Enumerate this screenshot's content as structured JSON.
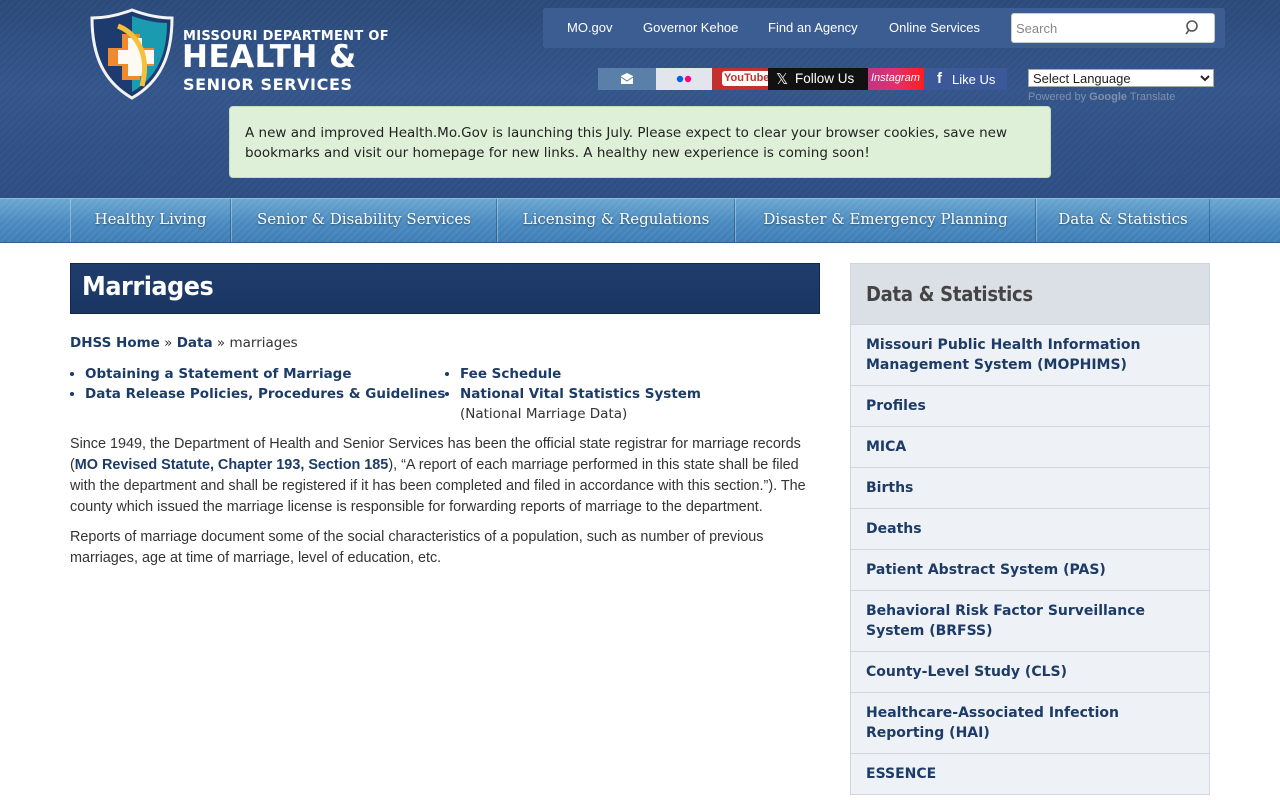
{
  "header": {
    "logo": {
      "line1": "MISSOURI DEPARTMENT OF",
      "line2": "HEALTH &",
      "line3": "SENIOR SERVICES"
    },
    "top_links": [
      "MO.gov",
      "Governor Kehoe",
      "Find an Agency",
      "Online Services"
    ],
    "search": {
      "placeholder": "Search"
    },
    "social": {
      "youtube": "YouTube",
      "x": "Follow Us",
      "instagram": "Instagram",
      "facebook": "Like Us"
    },
    "language": {
      "selected": "Select Language"
    },
    "powered_by": {
      "prefix": "Powered by",
      "google": "Google",
      "suffix": "Translate"
    }
  },
  "alert": {
    "text": "A new and improved Health.Mo.Gov is launching this July. Please expect to clear your browser cookies, save new bookmarks and visit our homepage for new links. A healthy new experience is coming soon!"
  },
  "main_nav": [
    "Healthy Living",
    "Senior & Disability Services",
    "Licensing & Regulations",
    "Disaster & Emergency Planning",
    "Data & Statistics"
  ],
  "page": {
    "title": "Marriages",
    "breadcrumb": {
      "home": "DHSS Home",
      "sep": "»",
      "data": "Data",
      "current": "marriages"
    },
    "links_left": [
      "Obtaining a Statement of Marriage",
      "Data Release Policies, Procedures & Guidelines"
    ],
    "links_right": [
      "Fee Schedule",
      "National Vital Statistics System"
    ],
    "links_right_note": "(National Marriage Data)",
    "para1_start": "Since 1949, the Department of Health and Senior Services has been the official state registrar for marriage records (",
    "para1_link": "MO Revised Statute, Chapter 193, Section 185",
    "para1_end": "), “A report of each marriage performed in this state shall be filed with the department and shall be registered if it has been completed and filed in accordance with this section.”). The county which issued the marriage license is responsible for forwarding reports of marriage to the department.",
    "para2": "Reports of marriage document some of the social characteristics of a population, such as number of previous marriages, age at time of marriage, level of education, etc."
  },
  "sidebar": {
    "title": "Data & Statistics",
    "items": [
      "Missouri Public Health Information Management System (MOPHIMS)",
      "Profiles",
      "MICA",
      "Births",
      "Deaths",
      "Patient Abstract System (PAS)",
      "Behavioral Risk Factor Surveillance System (BRFSS)",
      "County-Level Study (CLS)",
      "Healthcare-Associated Infection Reporting (HAI)",
      "ESSENCE"
    ]
  },
  "colors": {
    "header_bg": "#2d4e82",
    "nav_bg": "#4a8ac0",
    "title_bg": "#1a3562",
    "link": "#1c3b66",
    "alert_bg": "#dff0d8"
  }
}
